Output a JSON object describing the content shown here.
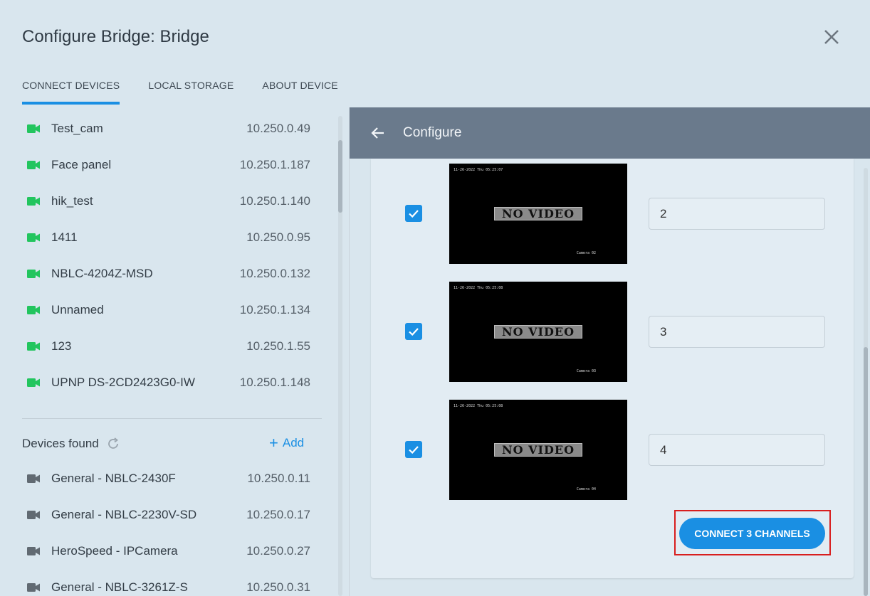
{
  "header": {
    "title": "Configure Bridge: Bridge",
    "tabs": [
      "CONNECT DEVICES",
      "LOCAL STORAGE",
      "ABOUT DEVICE"
    ]
  },
  "connected_devices": [
    {
      "name": "Test_cam",
      "ip": "10.250.0.49"
    },
    {
      "name": "Face panel",
      "ip": "10.250.1.187"
    },
    {
      "name": "hik_test",
      "ip": "10.250.1.140"
    },
    {
      "name": "1411",
      "ip": "10.250.0.95"
    },
    {
      "name": "NBLC-4204Z-MSD",
      "ip": "10.250.0.132"
    },
    {
      "name": "Unnamed",
      "ip": "10.250.1.134"
    },
    {
      "name": "123",
      "ip": "10.250.1.55"
    },
    {
      "name": "UPNP DS-2CD2423G0-IW",
      "ip": "10.250.1.148"
    }
  ],
  "devices_found": {
    "label": "Devices found",
    "add_label": "Add",
    "items": [
      {
        "name": "General - NBLC-2430F",
        "ip": "10.250.0.11"
      },
      {
        "name": "General - NBLC-2230V-SD",
        "ip": "10.250.0.17"
      },
      {
        "name": "HeroSpeed - IPCamera",
        "ip": "10.250.0.27"
      },
      {
        "name": "General - NBLC-3261Z-S",
        "ip": "10.250.0.31"
      }
    ]
  },
  "configure": {
    "title": "Configure",
    "channels": [
      {
        "checked": true,
        "timestamp": "11-26-2022 Thu 05:25:07",
        "no_video": "NO VIDEO",
        "camera_label": "Camera 02",
        "value": "2"
      },
      {
        "checked": true,
        "timestamp": "11-26-2022 Thu 05:25:08",
        "no_video": "NO VIDEO",
        "camera_label": "Camera 03",
        "value": "3"
      },
      {
        "checked": true,
        "timestamp": "11-26-2022 Thu 05:25:08",
        "no_video": "NO VIDEO",
        "camera_label": "Camera 04",
        "value": "4"
      }
    ],
    "connect_button": "CONNECT 3 CHANNELS"
  },
  "colors": {
    "accent": "#1a8fe3",
    "connected_icon": "#22c55e",
    "found_icon": "#616a72",
    "config_bar": "#6a7a8c",
    "highlight": "#d81e1e"
  },
  "icons": {
    "close": "close-icon",
    "camera": "video-camera-icon",
    "refresh": "refresh-icon",
    "back": "arrow-left-icon",
    "check": "checkmark-icon"
  }
}
